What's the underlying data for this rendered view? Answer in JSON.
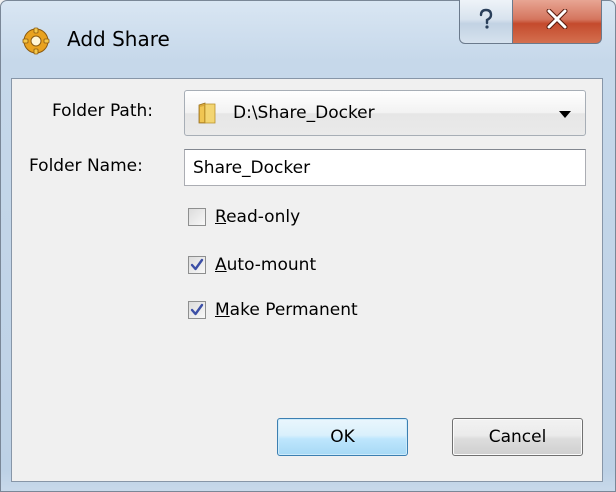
{
  "window": {
    "title": "Add Share",
    "app_icon": "gear-icon",
    "help_icon": "question-mark-icon",
    "close_icon": "close-x-icon"
  },
  "form": {
    "folder_path_label": "Folder Path:",
    "folder_path_value": "D:\\Share_Docker",
    "folder_path_icon": "folder-icon",
    "folder_name_label": "Folder Name:",
    "folder_name_value": "Share_Docker"
  },
  "options": [
    {
      "mnemonic": "R",
      "rest": "ead-only",
      "checked": false
    },
    {
      "mnemonic": "A",
      "rest": "uto-mount",
      "checked": true
    },
    {
      "mnemonic": "M",
      "rest": "ake Permanent",
      "checked": true
    }
  ],
  "buttons": {
    "ok_label": "OK",
    "cancel_label": "Cancel"
  },
  "colors": {
    "check_mark": "#3c4fa6",
    "close_button": "#c44a2d",
    "ok_border": "#3c7fb1"
  }
}
